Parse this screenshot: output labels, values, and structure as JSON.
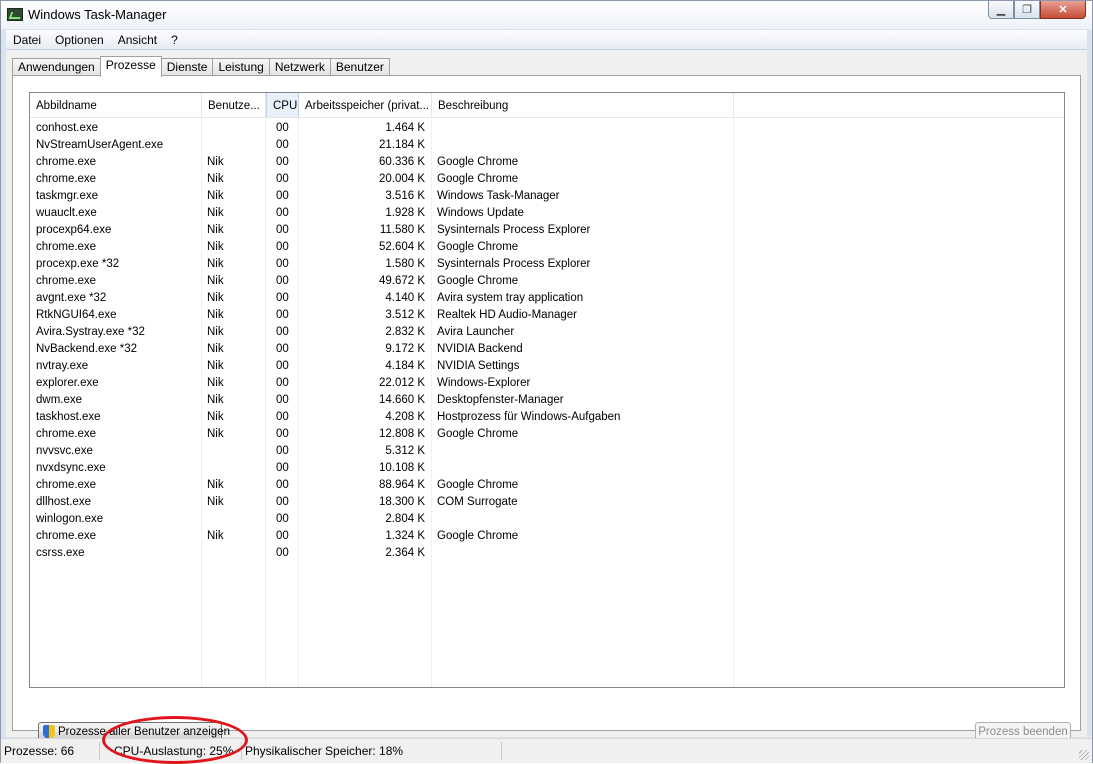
{
  "window": {
    "title": "Windows Task-Manager"
  },
  "menu": [
    "Datei",
    "Optionen",
    "Ansicht",
    "?"
  ],
  "tabs": [
    "Anwendungen",
    "Prozesse",
    "Dienste",
    "Leistung",
    "Netzwerk",
    "Benutzer"
  ],
  "active_tab": "Prozesse",
  "columns": {
    "name": "Abbildname",
    "user": "Benutze...",
    "cpu": "CPU",
    "mem": "Arbeitsspeicher (privat...",
    "desc": "Beschreibung"
  },
  "processes": [
    {
      "name": "conhost.exe",
      "user": "",
      "cpu": "00",
      "mem": "1.464 K",
      "desc": ""
    },
    {
      "name": "NvStreamUserAgent.exe",
      "user": "",
      "cpu": "00",
      "mem": "21.184 K",
      "desc": ""
    },
    {
      "name": "chrome.exe",
      "user": "Nik",
      "cpu": "00",
      "mem": "60.336 K",
      "desc": "Google Chrome"
    },
    {
      "name": "chrome.exe",
      "user": "Nik",
      "cpu": "00",
      "mem": "20.004 K",
      "desc": "Google Chrome"
    },
    {
      "name": "taskmgr.exe",
      "user": "Nik",
      "cpu": "00",
      "mem": "3.516 K",
      "desc": "Windows Task-Manager"
    },
    {
      "name": "wuauclt.exe",
      "user": "Nik",
      "cpu": "00",
      "mem": "1.928 K",
      "desc": "Windows Update"
    },
    {
      "name": "procexp64.exe",
      "user": "Nik",
      "cpu": "00",
      "mem": "11.580 K",
      "desc": "Sysinternals Process Explorer"
    },
    {
      "name": "chrome.exe",
      "user": "Nik",
      "cpu": "00",
      "mem": "52.604 K",
      "desc": "Google Chrome"
    },
    {
      "name": "procexp.exe *32",
      "user": "Nik",
      "cpu": "00",
      "mem": "1.580 K",
      "desc": "Sysinternals Process Explorer"
    },
    {
      "name": "chrome.exe",
      "user": "Nik",
      "cpu": "00",
      "mem": "49.672 K",
      "desc": "Google Chrome"
    },
    {
      "name": "avgnt.exe *32",
      "user": "Nik",
      "cpu": "00",
      "mem": "4.140 K",
      "desc": "Avira system tray application"
    },
    {
      "name": "RtkNGUI64.exe",
      "user": "Nik",
      "cpu": "00",
      "mem": "3.512 K",
      "desc": "Realtek HD Audio-Manager"
    },
    {
      "name": "Avira.Systray.exe *32",
      "user": "Nik",
      "cpu": "00",
      "mem": "2.832 K",
      "desc": "Avira Launcher"
    },
    {
      "name": "NvBackend.exe *32",
      "user": "Nik",
      "cpu": "00",
      "mem": "9.172 K",
      "desc": "NVIDIA Backend"
    },
    {
      "name": "nvtray.exe",
      "user": "Nik",
      "cpu": "00",
      "mem": "4.184 K",
      "desc": "NVIDIA Settings"
    },
    {
      "name": "explorer.exe",
      "user": "Nik",
      "cpu": "00",
      "mem": "22.012 K",
      "desc": "Windows-Explorer"
    },
    {
      "name": "dwm.exe",
      "user": "Nik",
      "cpu": "00",
      "mem": "14.660 K",
      "desc": "Desktopfenster-Manager"
    },
    {
      "name": "taskhost.exe",
      "user": "Nik",
      "cpu": "00",
      "mem": "4.208 K",
      "desc": "Hostprozess für Windows-Aufgaben"
    },
    {
      "name": "chrome.exe",
      "user": "Nik",
      "cpu": "00",
      "mem": "12.808 K",
      "desc": "Google Chrome"
    },
    {
      "name": "nvvsvc.exe",
      "user": "",
      "cpu": "00",
      "mem": "5.312 K",
      "desc": ""
    },
    {
      "name": "nvxdsync.exe",
      "user": "",
      "cpu": "00",
      "mem": "10.108 K",
      "desc": ""
    },
    {
      "name": "chrome.exe",
      "user": "Nik",
      "cpu": "00",
      "mem": "88.964 K",
      "desc": "Google Chrome"
    },
    {
      "name": "dllhost.exe",
      "user": "Nik",
      "cpu": "00",
      "mem": "18.300 K",
      "desc": "COM Surrogate"
    },
    {
      "name": "winlogon.exe",
      "user": "",
      "cpu": "00",
      "mem": "2.804 K",
      "desc": ""
    },
    {
      "name": "chrome.exe",
      "user": "Nik",
      "cpu": "00",
      "mem": "1.324 K",
      "desc": "Google Chrome"
    },
    {
      "name": "csrss.exe",
      "user": "",
      "cpu": "00",
      "mem": "2.364 K",
      "desc": ""
    }
  ],
  "buttons": {
    "show_all": "Prozesse aller Benutzer anzeigen",
    "end_process": "Prozess beenden"
  },
  "status": {
    "processes": "Prozesse: 66",
    "cpu": "CPU-Auslastung: 25%",
    "memory": "Physikalischer Speicher: 18%"
  },
  "annotation_color": "#e0151b"
}
